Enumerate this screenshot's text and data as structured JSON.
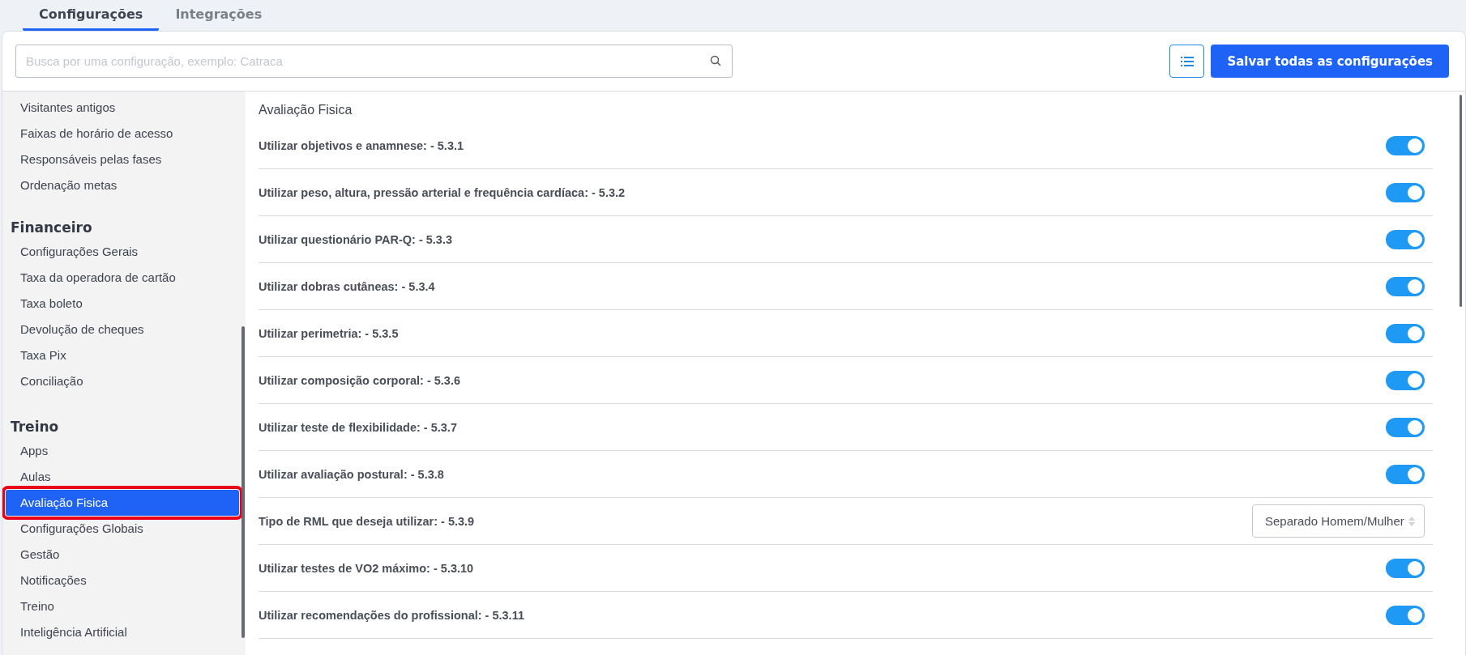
{
  "tabs": [
    {
      "label": "Configurações",
      "selected": true
    },
    {
      "label": "Integrações",
      "selected": false
    }
  ],
  "search": {
    "placeholder": "Busca por uma configuração, exemplo: Catraca"
  },
  "save_button": "Salvar todas as configurações",
  "sidebar": {
    "groups": [
      {
        "items": [
          {
            "label": "Visitantes antigos",
            "selected": false
          },
          {
            "label": "Faixas de horário de acesso",
            "selected": false
          },
          {
            "label": "Responsáveis pelas fases",
            "selected": false
          },
          {
            "label": "Ordenação metas",
            "selected": false
          }
        ]
      },
      {
        "title": "Financeiro",
        "items": [
          {
            "label": "Configurações Gerais",
            "selected": false
          },
          {
            "label": "Taxa da operadora de cartão",
            "selected": false
          },
          {
            "label": "Taxa boleto",
            "selected": false
          },
          {
            "label": "Devolução de cheques",
            "selected": false
          },
          {
            "label": "Taxa Pix",
            "selected": false
          },
          {
            "label": "Conciliação",
            "selected": false
          }
        ]
      },
      {
        "title": "Treino",
        "items": [
          {
            "label": "Apps",
            "selected": false
          },
          {
            "label": "Aulas",
            "selected": false
          },
          {
            "label": "Avaliação Fisica",
            "selected": true
          },
          {
            "label": "Configurações Globais",
            "selected": false
          },
          {
            "label": "Gestão",
            "selected": false
          },
          {
            "label": "Notificações",
            "selected": false
          },
          {
            "label": "Treino",
            "selected": false
          },
          {
            "label": "Inteligência Artificial",
            "selected": false
          }
        ]
      }
    ]
  },
  "section": {
    "title": "Avaliação Fisica",
    "rows": [
      {
        "kind": "toggle",
        "label": "Utilizar objetivos e anamnese: - 5.3.1",
        "on": true
      },
      {
        "kind": "toggle",
        "label": "Utilizar peso, altura, pressão arterial e frequência cardíaca: - 5.3.2",
        "on": true
      },
      {
        "kind": "toggle",
        "label": "Utilizar questionário PAR-Q: - 5.3.3",
        "on": true
      },
      {
        "kind": "toggle",
        "label": "Utilizar dobras cutâneas: - 5.3.4",
        "on": true
      },
      {
        "kind": "toggle",
        "label": "Utilizar perimetria: - 5.3.5",
        "on": true
      },
      {
        "kind": "toggle",
        "label": "Utilizar composição corporal: - 5.3.6",
        "on": true
      },
      {
        "kind": "toggle",
        "label": "Utilizar teste de flexibilidade: - 5.3.7",
        "on": true
      },
      {
        "kind": "toggle",
        "label": "Utilizar avaliação postural: - 5.3.8",
        "on": true
      },
      {
        "kind": "select",
        "label": "Tipo de RML que deseja utilizar: - 5.3.9",
        "value": "Separado Homem/Mulher"
      },
      {
        "kind": "toggle",
        "label": "Utilizar testes de VO2 máximo: - 5.3.10",
        "on": true
      },
      {
        "kind": "toggle",
        "label": "Utilizar recomendações do profissional: - 5.3.11",
        "on": true
      }
    ]
  }
}
